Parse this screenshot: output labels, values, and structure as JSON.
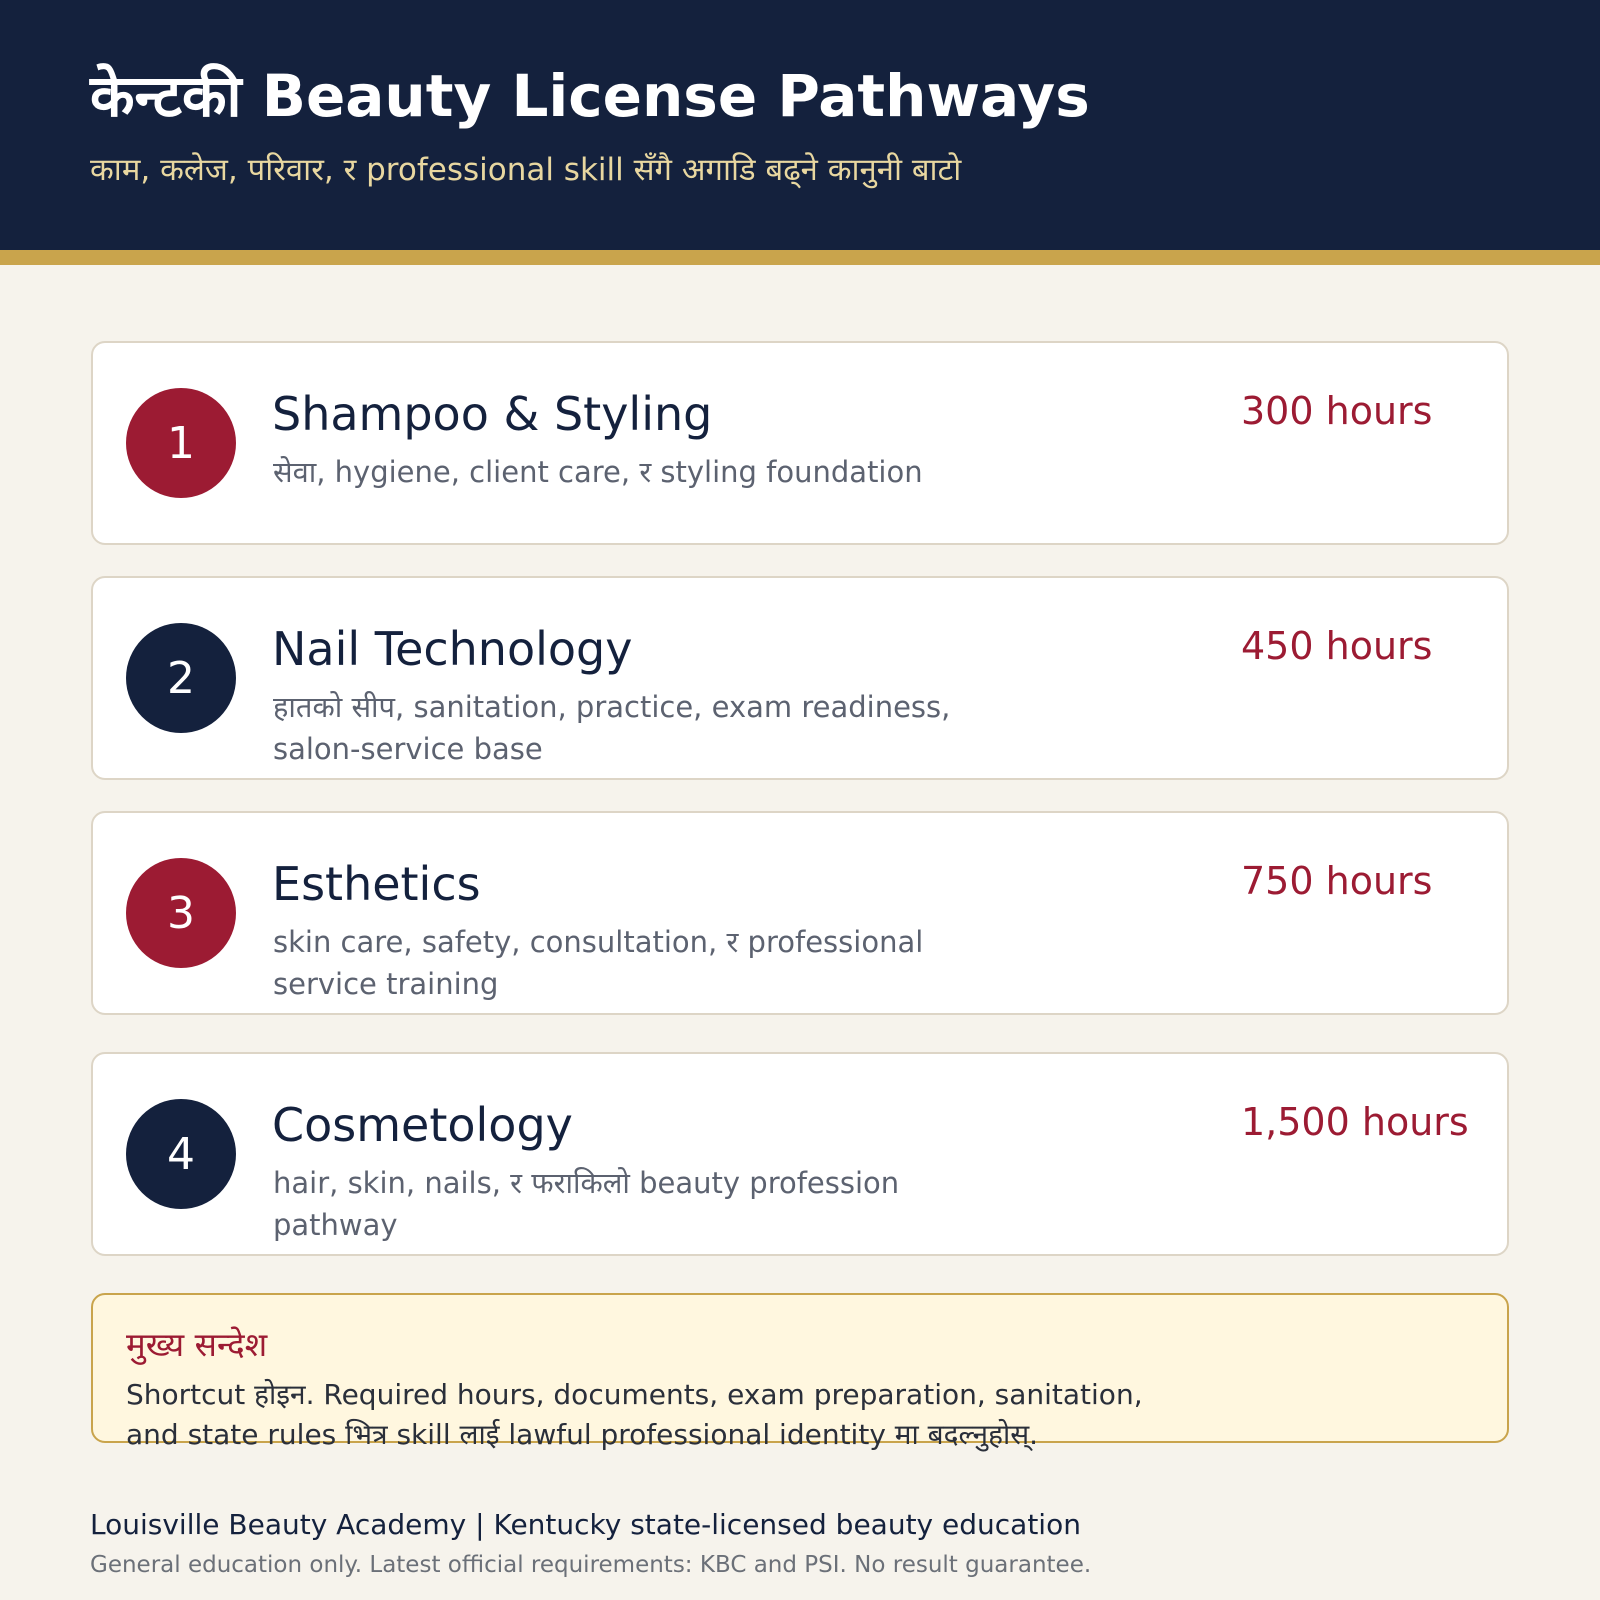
{
  "header": {
    "title": "केन्टकी Beauty License Pathways",
    "subtitle": "काम, कलेज, परिवार, र professional skill सँगै अगाडि बढ्ने कानुनी बाटो"
  },
  "pathways": [
    {
      "number": "1",
      "title": "Shampoo & Styling",
      "description": "सेवा, hygiene, client care, र styling foundation",
      "hours": "300 hours"
    },
    {
      "number": "2",
      "title": "Nail Technology",
      "description": "हातको सीप, sanitation, practice, exam readiness, salon-service base",
      "hours": "450 hours"
    },
    {
      "number": "3",
      "title": "Esthetics",
      "description": "skin care, safety, consultation, र professional service training",
      "hours": "750 hours"
    },
    {
      "number": "4",
      "title": "Cosmetology",
      "description": "hair, skin, nails, र फराकिलो beauty profession pathway",
      "hours": "1,500 hours"
    }
  ],
  "note": {
    "heading": "मुख्य सन्देश",
    "body": "Shortcut होइन. Required hours, documents, exam preparation, sanitation, and state rules भित्र skill लाई lawful professional identity मा बदल्नुहोस्."
  },
  "footer": {
    "main": "Louisville Beauty Academy | Kentucky state-licensed beauty education",
    "disclaimer": "General education only. Latest official requirements: KBC and PSI. No result guarantee."
  },
  "colors": {
    "navy": "#14213d",
    "gold": "#c9a44c",
    "accent_red": "#9c1b33",
    "background": "#f6f3ec"
  }
}
